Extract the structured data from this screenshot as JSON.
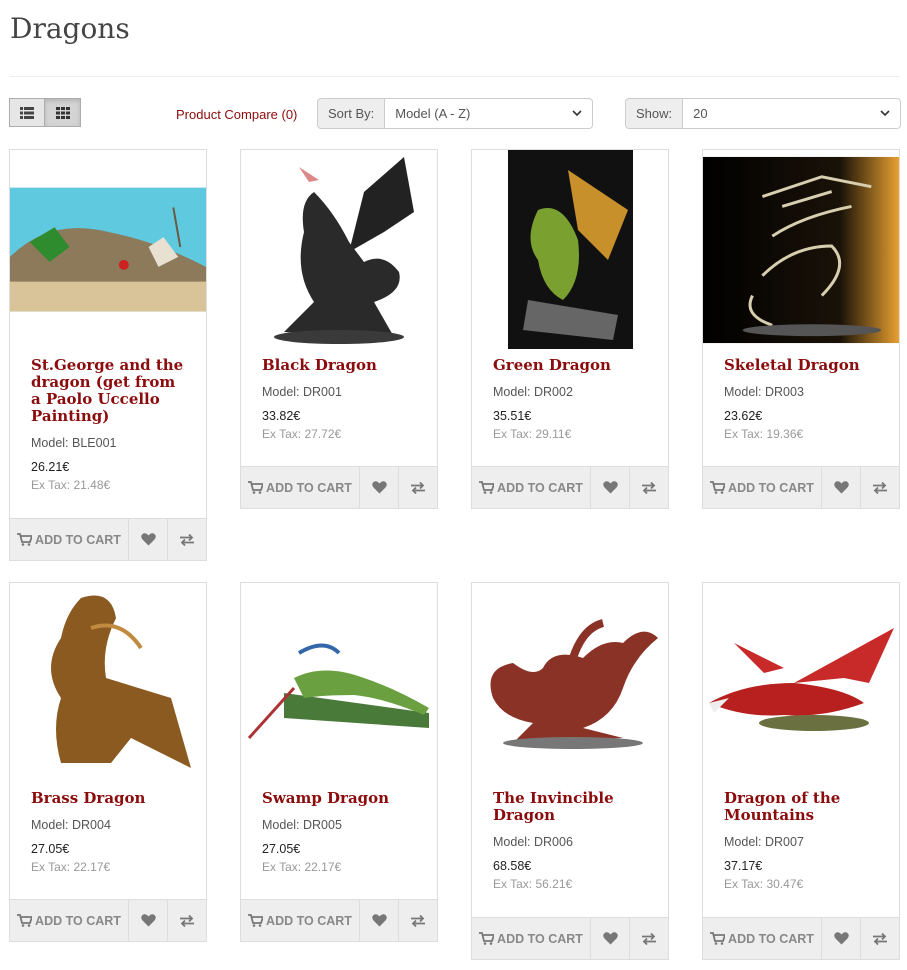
{
  "page": {
    "title": "Dragons"
  },
  "toolbar": {
    "list_view_icon": "list-icon",
    "grid_view_icon": "grid-icon",
    "compare_label": "Product Compare (0)",
    "sort_label": "Sort By:",
    "sort_value": "Model (A - Z)",
    "show_label": "Show:",
    "show_value": "20"
  },
  "buttons": {
    "add_to_cart": "ADD TO CART"
  },
  "icons": {
    "cart": "cart-icon",
    "wishlist": "heart-icon",
    "compare": "compare-arrows-icon",
    "dropdown": "chevron-down-icon"
  },
  "colors": {
    "accent": "#8b0c0c",
    "button_bg": "#eeeeee",
    "border": "#dddddd"
  },
  "products": [
    {
      "name": "St.George and the dragon (get from a Paolo Uccello Painting)",
      "model": "Model: BLE001",
      "price": "26.21€",
      "ex_tax": "Ex Tax: 21.48€",
      "image": "diorama-scene"
    },
    {
      "name": "Black Dragon",
      "model": "Model: DR001",
      "price": "33.82€",
      "ex_tax": "Ex Tax: 27.72€",
      "image": "black-dragon-figure"
    },
    {
      "name": "Green Dragon",
      "model": "Model: DR002",
      "price": "35.51€",
      "ex_tax": "Ex Tax: 29.11€",
      "image": "green-dragon-figure"
    },
    {
      "name": "Skeletal Dragon",
      "model": "Model: DR003",
      "price": "23.62€",
      "ex_tax": "Ex Tax: 19.36€",
      "image": "skeletal-dragon-figure"
    },
    {
      "name": "Brass Dragon",
      "model": "Model: DR004",
      "price": "27.05€",
      "ex_tax": "Ex Tax: 22.17€",
      "image": "brass-dragon-figure"
    },
    {
      "name": "Swamp Dragon",
      "model": "Model: DR005",
      "price": "27.05€",
      "ex_tax": "Ex Tax: 22.17€",
      "image": "swamp-dragon-figure"
    },
    {
      "name": "The Invincible Dragon",
      "model": "Model: DR006",
      "price": "68.58€",
      "ex_tax": "Ex Tax: 56.21€",
      "image": "invincible-dragon-figure"
    },
    {
      "name": "Dragon of the Mountains",
      "model": "Model: DR007",
      "price": "37.17€",
      "ex_tax": "Ex Tax: 30.47€",
      "image": "mountain-dragon-figure"
    }
  ]
}
